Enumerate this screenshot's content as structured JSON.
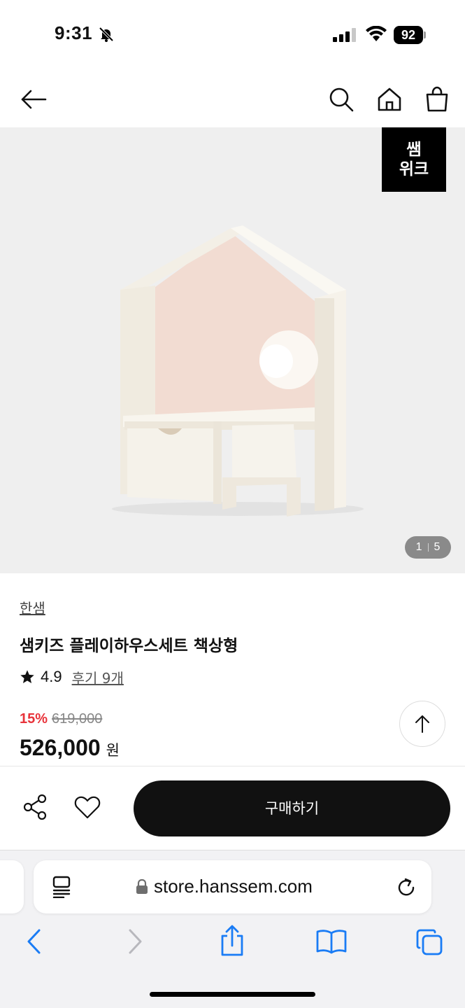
{
  "status_bar": {
    "time": "9:31",
    "battery": "92",
    "icons": [
      "bell-off-icon",
      "signal-icon",
      "wifi-icon",
      "battery-icon"
    ]
  },
  "nav": {
    "icons": [
      "back-arrow-icon",
      "search-icon",
      "home-icon",
      "shopping-bag-icon"
    ]
  },
  "hero": {
    "badge_line1": "쌤",
    "badge_line2": "위크",
    "pager_current": "1",
    "pager_total": "5"
  },
  "product": {
    "brand": "한샘",
    "title": "샘키즈 플레이하우스세트 책상형",
    "rating": "4.9",
    "review_link": "후기 9개",
    "discount": "15%",
    "original_price": "619,000",
    "price": "526,000",
    "currency": "원"
  },
  "action_bar": {
    "buy_label": "구매하기",
    "icons": [
      "share-icon",
      "heart-icon"
    ]
  },
  "browser": {
    "url": "store.hanssem.com",
    "icons": [
      "reader-icon",
      "lock-icon",
      "reload-icon",
      "back-chevron-icon",
      "forward-chevron-icon",
      "share-up-icon",
      "bookmarks-icon",
      "tabs-icon"
    ]
  },
  "colors": {
    "accent_discount": "#e8333a",
    "buy_button": "#111111",
    "safari_blue": "#1a7cf5",
    "hero_bg": "#efefef"
  }
}
